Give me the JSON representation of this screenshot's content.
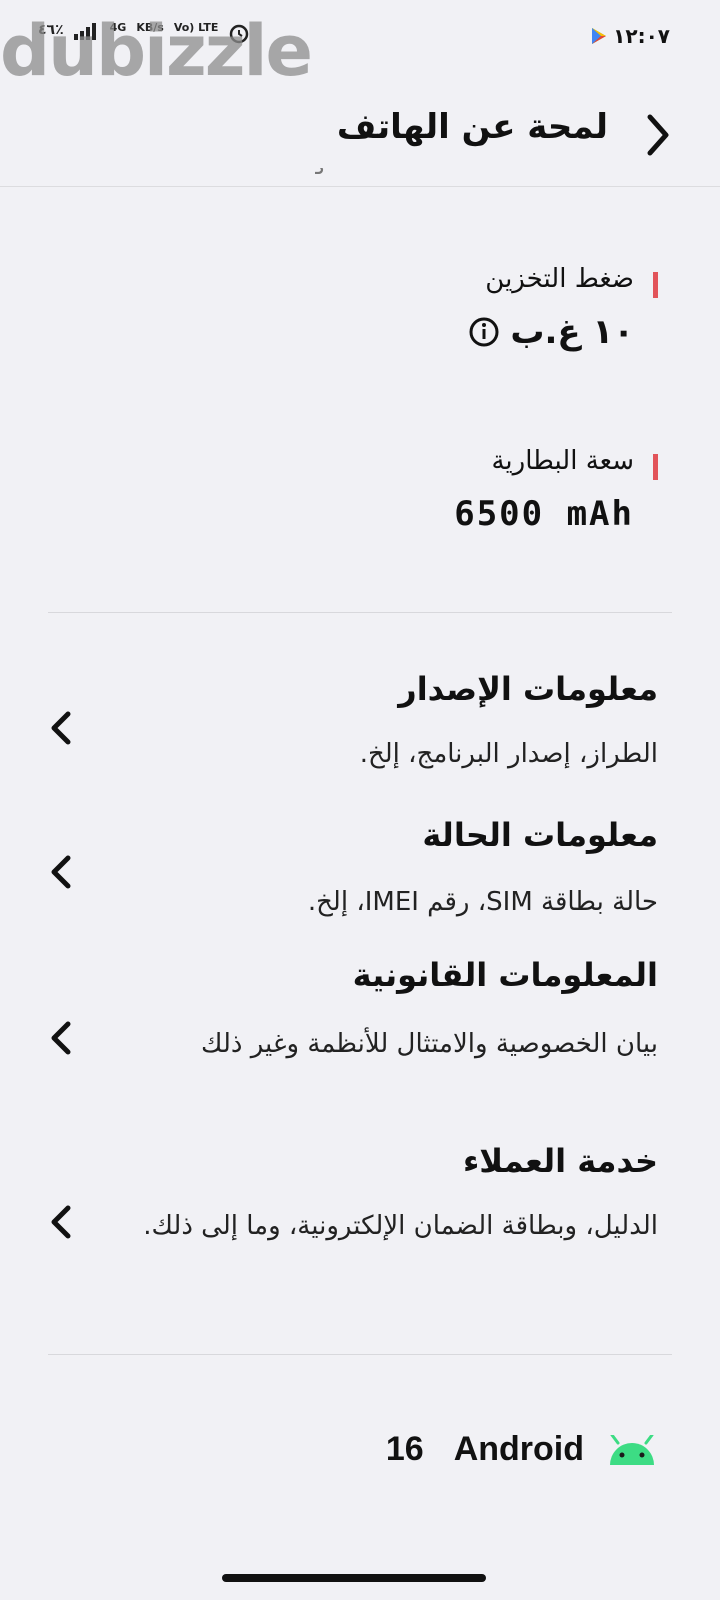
{
  "status_bar": {
    "time": "١٢:٠٧",
    "battery": "٤٦٪",
    "network": "4G",
    "speed": "KB/s",
    "volte": "Vo) LTE"
  },
  "watermark": "dubizzle",
  "header": {
    "title": "لمحة عن الهاتف"
  },
  "clipped_text": "ﮐ",
  "specs": [
    {
      "label": "ضغط التخزين",
      "value": "١٠ غ.ب"
    },
    {
      "label": "سعة البطارية",
      "value": "6500 mAh"
    }
  ],
  "menu": [
    {
      "title": "معلومات الإصدار",
      "subtitle": "الطراز، إصدار البرنامج، إلخ."
    },
    {
      "title": "معلومات الحالة",
      "subtitle": "حالة بطاقة SIM، رقم IMEI، إلخ."
    },
    {
      "title": "المعلومات القانونية",
      "subtitle": "بيان الخصوصية والامتثال للأنظمة وغير ذلك"
    },
    {
      "title": "خدمة العملاء",
      "subtitle": "الدليل، وبطاقة الضمان الإلكترونية، وما إلى ذلك."
    }
  ],
  "android": {
    "name": "Android",
    "version": "16"
  },
  "colors": {
    "accent_bar": "#e2545a",
    "android_green": "#3ddc84",
    "background": "#f1f1f5"
  }
}
